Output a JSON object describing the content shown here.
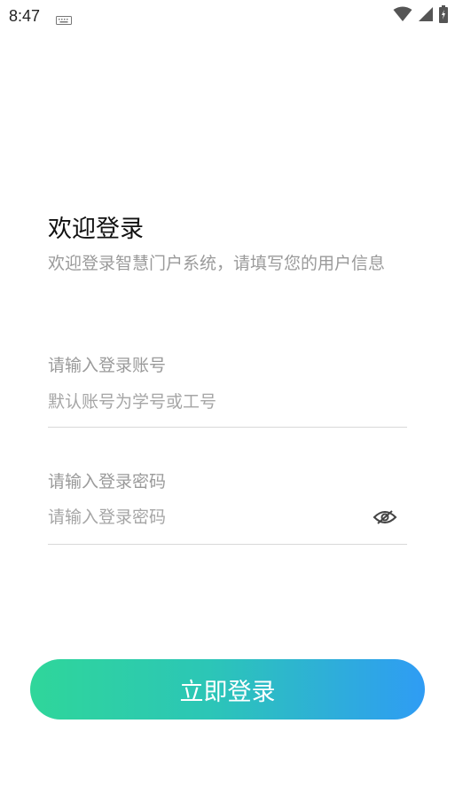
{
  "status_bar": {
    "time": "8:47",
    "icons": [
      "keyboard-icon",
      "wifi-icon",
      "cell-signal-icon",
      "battery-charging-icon"
    ]
  },
  "header": {
    "title": "欢迎登录",
    "subtitle": "欢迎登录智慧门户系统，请填写您的用户信息"
  },
  "account_field": {
    "label": "请输入登录账号",
    "value": "",
    "placeholder": "默认账号为学号或工号"
  },
  "password_field": {
    "label": "请输入登录密码",
    "value": "",
    "placeholder": "请输入登录密码",
    "toggle_icon": "eye-hidden-icon"
  },
  "login_button": {
    "label": "立即登录",
    "gradient": [
      "#2fd69a",
      "#2f9cf4"
    ]
  }
}
